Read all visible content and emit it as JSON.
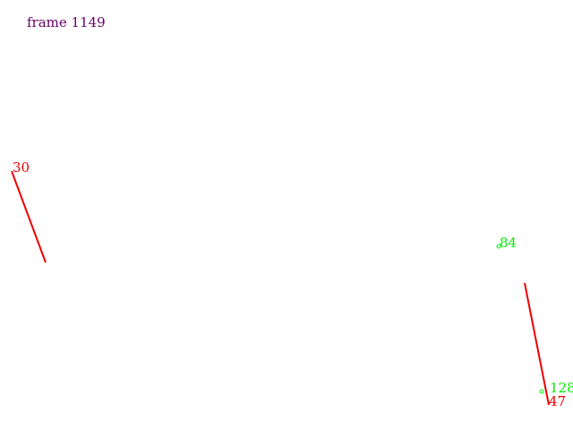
{
  "frame": {
    "label": "frame 1149",
    "color": "#660066"
  },
  "segments": [
    {
      "id": "30",
      "label": "30",
      "color": "#ee0000"
    },
    {
      "id": "47",
      "label": "47",
      "color": "#ee0000"
    }
  ],
  "points": [
    {
      "id": "84",
      "label": "84",
      "color": "#00ee00"
    },
    {
      "id": "128",
      "label": "128",
      "color": "#00ee00"
    }
  ]
}
